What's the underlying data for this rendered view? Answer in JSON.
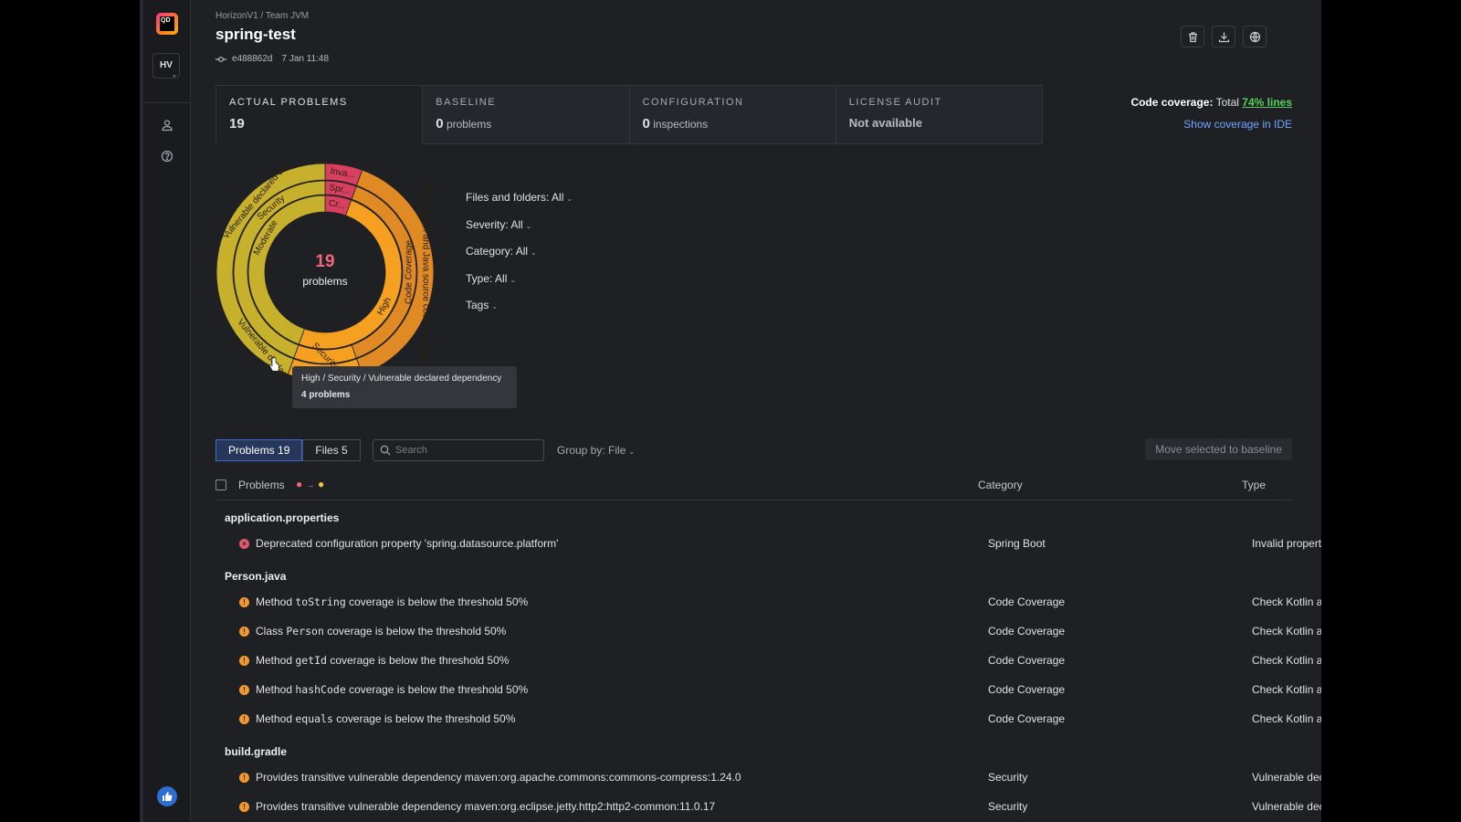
{
  "sidebar": {
    "logo_text": "QD",
    "org_badge": "HV"
  },
  "header": {
    "breadcrumb": "HorizonV1 / Team JVM",
    "title": "spring-test",
    "commit_hash": "e488862d",
    "commit_date": "7 Jan 11:48"
  },
  "tabs": [
    {
      "label": "ACTUAL PROBLEMS",
      "value": "19",
      "unit": ""
    },
    {
      "label": "BASELINE",
      "value": "0",
      "unit": "problems"
    },
    {
      "label": "CONFIGURATION",
      "value": "0",
      "unit": "inspections"
    },
    {
      "label": "LICENSE AUDIT",
      "value": "Not available",
      "unit": ""
    }
  ],
  "coverage": {
    "label": "Code coverage:",
    "total_label": "Total",
    "value": "74% lines",
    "ide_link": "Show coverage in IDE"
  },
  "donut": {
    "count": "19",
    "count_label": "problems",
    "colors": {
      "critical": "#d94060",
      "high": "#f5a020",
      "moderate": "#c6b02c",
      "coverage": "#e08a26"
    },
    "inner_labels": [
      "High",
      "Moderate",
      "Cr..."
    ],
    "middle_labels": [
      "Code Coverage",
      "Security",
      "Security",
      "Spr..."
    ],
    "outer_labels": [
      "Check Kotlin and Java source code coverage",
      "Vulnerable declared depe...",
      "Vulnerable declared...",
      "Inva..."
    ]
  },
  "filters": [
    {
      "label": "Files and folders: All"
    },
    {
      "label": "Severity: All"
    },
    {
      "label": "Category: All"
    },
    {
      "label": "Type: All"
    },
    {
      "label": "Tags"
    }
  ],
  "tooltip": {
    "path": "High / Security / Vulnerable declared dependency",
    "count": "4 problems"
  },
  "toolbar": {
    "problems_tab": "Problems 19",
    "files_tab": "Files 5",
    "search_placeholder": "Search",
    "group_by": "Group by: File",
    "move_button": "Move selected to baseline"
  },
  "table": {
    "col_problems": "Problems",
    "col_category": "Category",
    "col_type": "Type",
    "groups": [
      {
        "file": "application.properties",
        "rows": [
          {
            "severity": "error",
            "pre": "Deprecated configuration property 'spring.datasource.platform'",
            "code": "",
            "post": "",
            "category": "Spring Boot",
            "type": "Invalid properties configuration"
          }
        ]
      },
      {
        "file": "Person.java",
        "rows": [
          {
            "severity": "warning",
            "pre": "Method ",
            "code": "toString",
            "post": " coverage is below the threshold 50%",
            "category": "Code Coverage",
            "type": "Check Kotlin and Java source ..."
          },
          {
            "severity": "warning",
            "pre": "Class ",
            "code": "Person",
            "post": " coverage is below the threshold 50%",
            "category": "Code Coverage",
            "type": "Check Kotlin and Java source ..."
          },
          {
            "severity": "warning",
            "pre": "Method ",
            "code": "getId",
            "post": " coverage is below the threshold 50%",
            "category": "Code Coverage",
            "type": "Check Kotlin and Java source ..."
          },
          {
            "severity": "warning",
            "pre": "Method ",
            "code": "hashCode",
            "post": " coverage is below the threshold 50%",
            "category": "Code Coverage",
            "type": "Check Kotlin and Java source ..."
          },
          {
            "severity": "warning",
            "pre": "Method ",
            "code": "equals",
            "post": " coverage is below the threshold 50%",
            "category": "Code Coverage",
            "type": "Check Kotlin and Java source ..."
          }
        ]
      },
      {
        "file": "build.gradle",
        "rows": [
          {
            "severity": "warning",
            "pre": "Provides transitive vulnerable dependency maven:org.apache.commons:commons-compress:1.24.0",
            "code": "",
            "post": "",
            "category": "Security",
            "type": "Vulnerable declared depende..."
          },
          {
            "severity": "warning",
            "pre": "Provides transitive vulnerable dependency maven:org.eclipse.jetty.http2:http2-common:11.0.17",
            "code": "",
            "post": "",
            "category": "Security",
            "type": "Vulnerable declared depende..."
          }
        ]
      }
    ]
  }
}
